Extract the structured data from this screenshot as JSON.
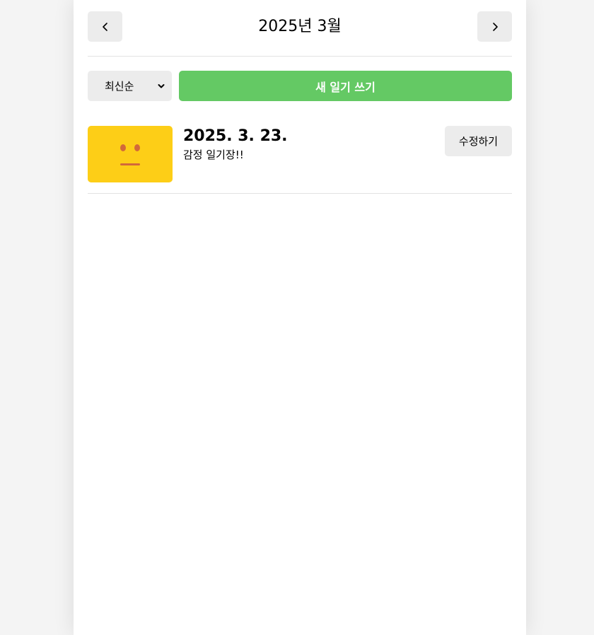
{
  "header": {
    "title": "2025년 3월",
    "prev_icon": "chevron-left-icon",
    "next_icon": "chevron-right-icon"
  },
  "menu": {
    "sort_selected": "최신순",
    "sort_icon": "chevron-down-icon",
    "new_button_label": "새 일기 쓰기"
  },
  "diaries": [
    {
      "date": "2025. 3. 23.",
      "content": "감정 일기장!!",
      "emotion_icon": "neutral-face-icon",
      "emotion_color": "#fdce17",
      "edit_label": "수정하기"
    }
  ],
  "colors": {
    "accent_green": "#64c964",
    "button_gray": "#ececec",
    "background": "#f4f4f4"
  }
}
